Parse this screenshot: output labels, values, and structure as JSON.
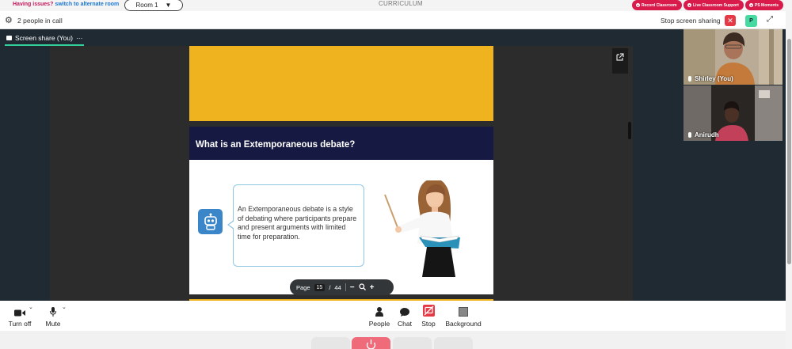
{
  "topbar": {
    "issues_text": "Having issues?",
    "alternate_link": "switch to alternate room",
    "room_label": "Room 1",
    "app_title": "CURRICULUM",
    "pills": [
      "Record Classroom",
      "Live Classroom Support",
      "PS Moments"
    ]
  },
  "callbar": {
    "people_count": "2 people in call",
    "stop_share": "Stop screen sharing",
    "avatar_initial": "P"
  },
  "stage": {
    "tab_label": "Screen share (You)",
    "tab_more": "···"
  },
  "slide": {
    "heading": "What is an Extemporaneous debate?",
    "bubble_text": "An Extemporaneous debate is a style of debating where participants prepare and present arguments with limited time for preparation."
  },
  "pdf": {
    "page_label": "Page",
    "current_page": "15",
    "separator": "/",
    "total_pages": "44",
    "zoom_out": "−",
    "zoom_in": "+"
  },
  "participants": [
    {
      "name": "Shirley (You)"
    },
    {
      "name": "Anirudh"
    }
  ],
  "controls": {
    "turn_off": "Turn off",
    "mute": "Mute",
    "people": "People",
    "chat": "Chat",
    "stop": "Stop",
    "background": "Background"
  },
  "colors": {
    "accent_red": "#d81b4a",
    "stop_red": "#e53946",
    "stage_bg": "#1f2a33",
    "slide_yellow": "#efb320",
    "slide_navy": "#161a42",
    "tab_underline": "#34d09b"
  }
}
